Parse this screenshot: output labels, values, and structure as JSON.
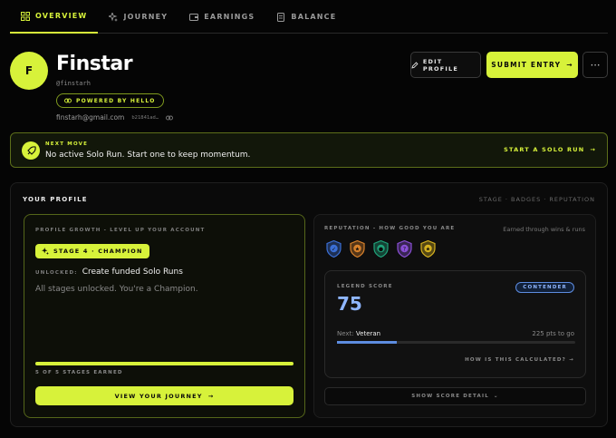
{
  "tabs": [
    {
      "label": "Overview",
      "icon": "grid-icon",
      "active": true
    },
    {
      "label": "Journey",
      "icon": "sparkle-icon",
      "active": false
    },
    {
      "label": "Earnings",
      "icon": "wallet-icon",
      "active": false
    },
    {
      "label": "Balance",
      "icon": "ledger-icon",
      "active": false
    }
  ],
  "profile": {
    "initial": "F",
    "name": "Finstar",
    "handle": "@finstarh",
    "powered_by": "Powered by Hello",
    "email": "finstarh@gmail.com",
    "address": "b21841ad…"
  },
  "actions": {
    "edit_label": "Edit profile",
    "submit_label": "Submit entry",
    "more_label": "⋯"
  },
  "next_move": {
    "label": "Next move",
    "message": "No active Solo Run. Start one to keep momentum.",
    "cta": "Start a Solo Run"
  },
  "your_profile": {
    "heading": "Your Profile",
    "subnav": "STAGE · BADGES · REPUTATION"
  },
  "growth": {
    "heading": "Profile growth - Level up your account",
    "stage_badge": "Stage 4 · Champion",
    "unlocked_key": "Unlocked:",
    "unlocked_value": "Create funded Solo Runs",
    "all_unlocked": "All stages unlocked. You're a Champion.",
    "progress": 1.0,
    "earned": "5 of 5 stages earned",
    "journey_button": "View your journey"
  },
  "reputation": {
    "heading": "Reputation - how good you are",
    "note": "Earned through wins & runs",
    "badges": [
      {
        "name": "shield-check-badge",
        "color": "#3b6fd6",
        "glyph": "✓"
      },
      {
        "name": "star-badge",
        "color": "#d9822b",
        "glyph": "★"
      },
      {
        "name": "drop-badge",
        "color": "#1fa37a",
        "glyph": "●"
      },
      {
        "name": "question-badge",
        "color": "#8a4fd6",
        "glyph": "?"
      },
      {
        "name": "gold-star-badge",
        "color": "#d6b21f",
        "glyph": "★"
      }
    ]
  },
  "legend": {
    "label": "Legend score",
    "tier": "Contender",
    "score": "75",
    "next_key": "Next:",
    "next_value": "Veteran",
    "points_to_go": "225 pts to go",
    "progress": 0.25,
    "how_link": "How is this calculated? →"
  },
  "detail_button": "Show score detail",
  "colors": {
    "accent": "#d7f23a",
    "score_blue": "#8fb6ff",
    "background": "#050505"
  }
}
